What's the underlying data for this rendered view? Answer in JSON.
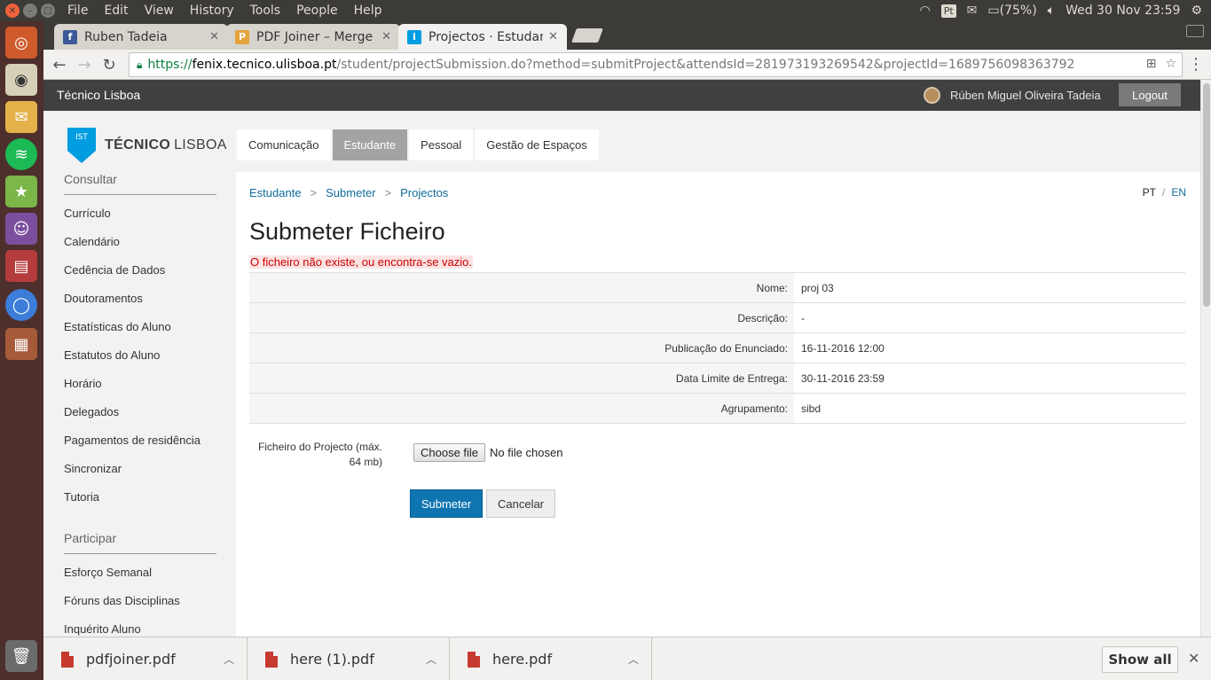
{
  "system": {
    "menu": [
      "File",
      "Edit",
      "View",
      "History",
      "Tools",
      "People",
      "Help"
    ],
    "keyboard_layout": "Pt",
    "battery": "(75%)",
    "clock": "Wed 30 Nov 23:59"
  },
  "browser": {
    "tabs": [
      {
        "title": "Ruben Tadeia",
        "icon": "facebook-icon"
      },
      {
        "title": "PDF Joiner – Merge",
        "icon": "pdf-joiner-icon"
      },
      {
        "title": "Projectos · Estudan",
        "icon": "ist-icon"
      }
    ],
    "url": {
      "scheme": "https://",
      "host": "fenix.tecnico.ulisboa.pt",
      "path": "/student/projectSubmission.do?method=submitProject&attendsId=281973193269542&projectId=1689756098363792"
    }
  },
  "topbar": {
    "site_name": "Técnico Lisboa",
    "user_name": "Rúben Miguel Oliveira Tadeia",
    "logout_label": "Logout"
  },
  "logo": {
    "part1": "TÉCNICO",
    "part2": "LISBOA",
    "mark": "IST"
  },
  "main_nav": [
    "Comunicação",
    "Estudante",
    "Pessoal",
    "Gestão de Espaços"
  ],
  "sidebar": {
    "consultar_heading": "Consultar",
    "consultar_items": [
      "Currículo",
      "Calendário",
      "Cedência de Dados",
      "Doutoramentos",
      "Estatísticas do Aluno",
      "Estatutos do Aluno",
      "Horário",
      "Delegados",
      "Pagamentos de residência",
      "Sincronizar",
      "Tutoria"
    ],
    "participar_heading": "Participar",
    "participar_items": [
      "Esforço Semanal",
      "Fóruns das Disciplinas",
      "Inquérito Aluno"
    ]
  },
  "breadcrumb": [
    "Estudante",
    "Submeter",
    "Projectos"
  ],
  "lang": {
    "pt": "PT",
    "sep": "/",
    "en": "EN"
  },
  "page": {
    "title": "Submeter Ficheiro",
    "error": "O ficheiro não existe, ou encontra-se vazio."
  },
  "details": [
    {
      "label": "Nome:",
      "value": "proj 03"
    },
    {
      "label": "Descrição:",
      "value": "-"
    },
    {
      "label": "Publicação do Enunciado:",
      "value": "16-11-2016 12:00"
    },
    {
      "label": "Data Limite de Entrega:",
      "value": "30-11-2016 23:59"
    },
    {
      "label": "Agrupamento:",
      "value": "sibd"
    }
  ],
  "form": {
    "file_label": "Ficheiro do Projecto (máx. 64 mb)",
    "choose_file": "Choose file",
    "no_file": "No file chosen",
    "submit": "Submeter",
    "cancel": "Cancelar"
  },
  "downloads": {
    "items": [
      "pdfjoiner.pdf",
      "here (1).pdf",
      "here.pdf"
    ],
    "show_all": "Show all"
  }
}
